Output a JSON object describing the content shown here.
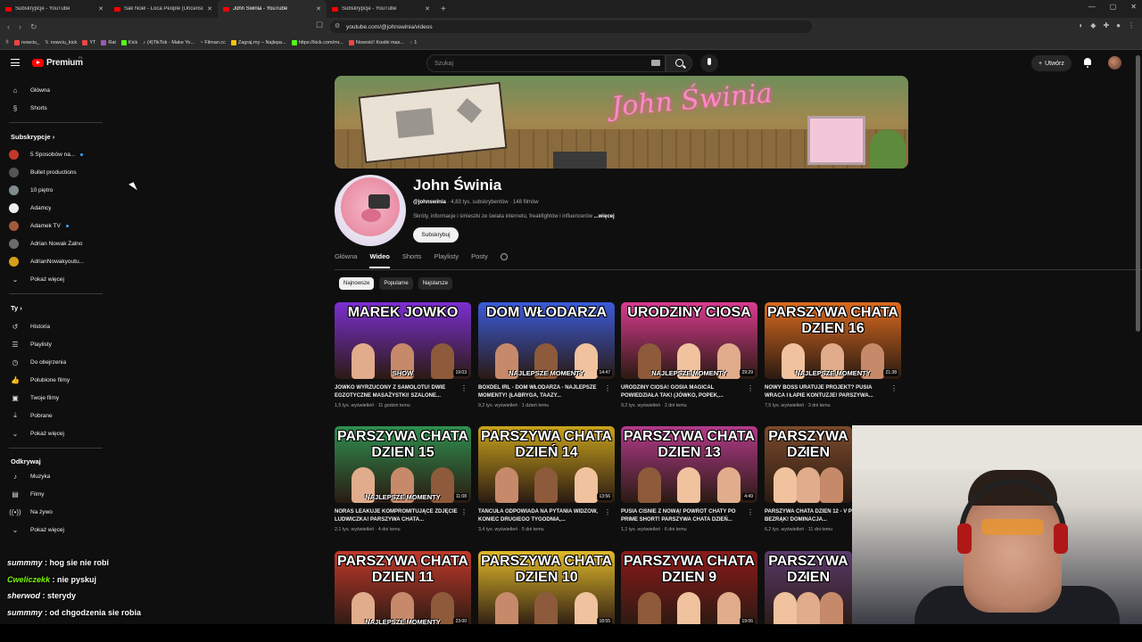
{
  "browser": {
    "tabs": [
      {
        "title": "Subskrypcje - YouTube",
        "active": false
      },
      {
        "title": "Sak Noel - Loca People (Uncensored",
        "active": false
      },
      {
        "title": "John Świnia - YouTube",
        "active": true
      },
      {
        "title": "Subskrypcje - YouTube",
        "active": false
      }
    ],
    "url": "youtube.com/@johnswinia/videos",
    "bookmarks": [
      "nowciu_",
      "nowciu_kick",
      "YT",
      "Rat",
      "Kick",
      "(4)TikTok - Make Yo...",
      "Filman.cc",
      "Zagraj.my – Najlepa...",
      "https://kick.com/mr...",
      "Nowość! Kostki mas...",
      "1"
    ]
  },
  "masthead": {
    "logo_text": "Premium",
    "logo_region": "PL",
    "search_placeholder": "Szukaj",
    "create_label": "Utwórz"
  },
  "sidebar": {
    "main": [
      {
        "label": "Główna",
        "icon": "home-icon"
      },
      {
        "label": "Shorts",
        "icon": "shorts-icon"
      }
    ],
    "subs_header": "Subskrypcje",
    "subs": [
      {
        "label": "5 Sposobów na...",
        "color": "#c0392b",
        "new": true
      },
      {
        "label": "Bullet productions",
        "color": "#555555",
        "new": false
      },
      {
        "label": "10 piętro",
        "color": "#7f8c8d",
        "new": false
      },
      {
        "label": "Adamcy",
        "color": "#ecf0f1",
        "new": false
      },
      {
        "label": "Adamek TV",
        "color": "#a05a3c",
        "new": true
      },
      {
        "label": "Adrian Nowak Żalno",
        "color": "#6b6b6b",
        "new": false
      },
      {
        "label": "AdrianNowakyoutu...",
        "color": "#d4a017",
        "new": false
      }
    ],
    "subs_more": "Pokaż więcej",
    "you_header": "Ty",
    "you": [
      {
        "label": "Historia",
        "icon": "history-icon"
      },
      {
        "label": "Playlisty",
        "icon": "playlist-icon"
      },
      {
        "label": "Do obejrzenia",
        "icon": "clock-icon"
      },
      {
        "label": "Polubione filmy",
        "icon": "thumb-up-icon"
      },
      {
        "label": "Twoje filmy",
        "icon": "video-icon"
      },
      {
        "label": "Pobrane",
        "icon": "download-icon"
      }
    ],
    "you_more": "Pokaż więcej",
    "explore_header": "Odkrywaj",
    "explore": [
      {
        "label": "Muzyka",
        "icon": "music-icon"
      },
      {
        "label": "Filmy",
        "icon": "film-icon"
      },
      {
        "label": "Na żywo",
        "icon": "live-icon"
      }
    ],
    "explore_more": "Pokaż więcej"
  },
  "channel": {
    "banner_text": "John Świnia",
    "name": "John Świnia",
    "handle": "@johnswinia",
    "stats": "· 4,83 tys. subskrybentów · 148 filmów",
    "description": "Skróty, informacje i śmieszki ze świata internetu, freakfightów i influencerów",
    "more": "...więcej",
    "subscribe": "Subskrybuj",
    "tabs": [
      "Główna",
      "Wideo",
      "Shorts",
      "Playlisty",
      "Posty"
    ],
    "active_tab": "Wideo",
    "chips": [
      "Najnowsze",
      "Popularne",
      "Najstarsze"
    ]
  },
  "videos": [
    {
      "t1": "MAREK JOWKO",
      "t2": "",
      "strip": "SHOW",
      "duration": "19:03",
      "bg": "#7b2fd1",
      "title": "JÓWKO WYRZUCONY Z SAMOLOTU! DWIE EGZOTYCZNE MASAŻYSTKI! SZALONE...",
      "meta": "1,5 tys. wyświetleń · 11 godzin temu"
    },
    {
      "t1": "DOM WŁODARZA",
      "t2": "",
      "strip": "NAJLEPSZE MOMENTY",
      "duration": "14:47",
      "bg": "#3b5bd9",
      "title": "BOXDEL IRL - DOM WŁODARZA - NAJLEPSZE MOMENTY! (ŁABRYGA, TAAZY...",
      "meta": "9,2 tys. wyświetleń · 1 dzień temu"
    },
    {
      "t1": "URODZINY CIOSA",
      "t2": "",
      "strip": "NAJLEPSZE MOMENTY",
      "duration": "29:29",
      "bg": "#d93b8f",
      "title": "URODZINY CIOSA! GOSIA MAGICAL POWIEDZIAŁA TAK! (JÓWKO, POPEK,...",
      "meta": "9,2 tys. wyświetleń · 2 dni temu"
    },
    {
      "t1": "PARSZYWA CHATA",
      "t2": "DZIEN 16",
      "strip": "NAJLEPSZE MOMENTY",
      "duration": "21:38",
      "bg": "#d96a1f",
      "title": "NOWY BOSS URATUJE PROJEKT? PUSIA WRACA I ŁAPIE KONTUZJE! PARSZYWA...",
      "meta": "7,5 tys. wyświetleń · 3 dni temu"
    },
    {
      "t1": "PARSZYWA CHATA",
      "t2": "DZIEN 15",
      "strip": "NAJLEPSZE MOMENTY",
      "duration": "11:08",
      "bg": "#2f8f4f",
      "title": "NORAS LEAKUJE KOMPROMITUJĄCE ZDJĘCIE LUDWICZKA! PARSZYWA CHATA...",
      "meta": "2,1 tys. wyświetleń · 4 dni temu"
    },
    {
      "t1": "PARSZYWA CHATA",
      "t2": "DZIEŃ 14",
      "strip": "",
      "duration": "13:56",
      "bg": "#c8a21c",
      "title": "TAŃCUŁA ODPOWIADA NA PYTANIA WIDZÓW, KONIEC DRUGIEGO TYGODNIA,...",
      "meta": "3,4 tys. wyświetleń · 5 dni temu"
    },
    {
      "t1": "PARSZYWA CHATA",
      "t2": "DZIEN 13",
      "strip": "",
      "duration": "4:49",
      "bg": "#b23a8a",
      "title": "PUSIA CIŚNIE Z NOWĄ! POWRÓT CHATY PO PRIME SHORT! PARSZYWA CHATA DZIEŃ...",
      "meta": "1,1 tys. wyświetleń · 6 dni temu"
    },
    {
      "t1": "PARSZYWA C",
      "t2": "DZIEN",
      "strip": "",
      "duration": "",
      "bg": "#7a4a2b",
      "title": "PARSZYWA CHATA DZIEŃ 12 - V PREZES BEZRĄK! DOMINACJA...",
      "meta": "6,2 tys. wyświetleń · 11 dni temu"
    },
    {
      "t1": "PARSZYWA CHATA",
      "t2": "DZIEN 11",
      "strip": "NAJLEPSZE MOMENTY",
      "duration": "23:00",
      "bg": "#c0392b",
      "title": "",
      "meta": ""
    },
    {
      "t1": "PARSZYWA CHATA",
      "t2": "DZIEN 10",
      "strip": "",
      "duration": "18:55",
      "bg": "#e0b82a",
      "title": "",
      "meta": ""
    },
    {
      "t1": "PARSZYWA CHATA",
      "t2": "DZIEN 9",
      "strip": "",
      "duration": "19:06",
      "bg": "#8b1a1a",
      "title": "",
      "meta": ""
    },
    {
      "t1": "PARSZYWA C",
      "t2": "DZIEN",
      "strip": "",
      "duration": "",
      "bg": "#5a3a6b",
      "title": "",
      "meta": ""
    }
  ],
  "chat": [
    {
      "user": "summmy",
      "text": ": hog sie nie robi",
      "color": "#ffffff"
    },
    {
      "user": "Cweliczekk",
      "text": ": nie pyskuj",
      "color": "#7cfc00"
    },
    {
      "user": "sherwod",
      "text": ": sterydy",
      "color": "#ffffff"
    },
    {
      "user": "summmy",
      "text": ": od chgodzenia sie robia",
      "color": "#ffffff"
    }
  ]
}
